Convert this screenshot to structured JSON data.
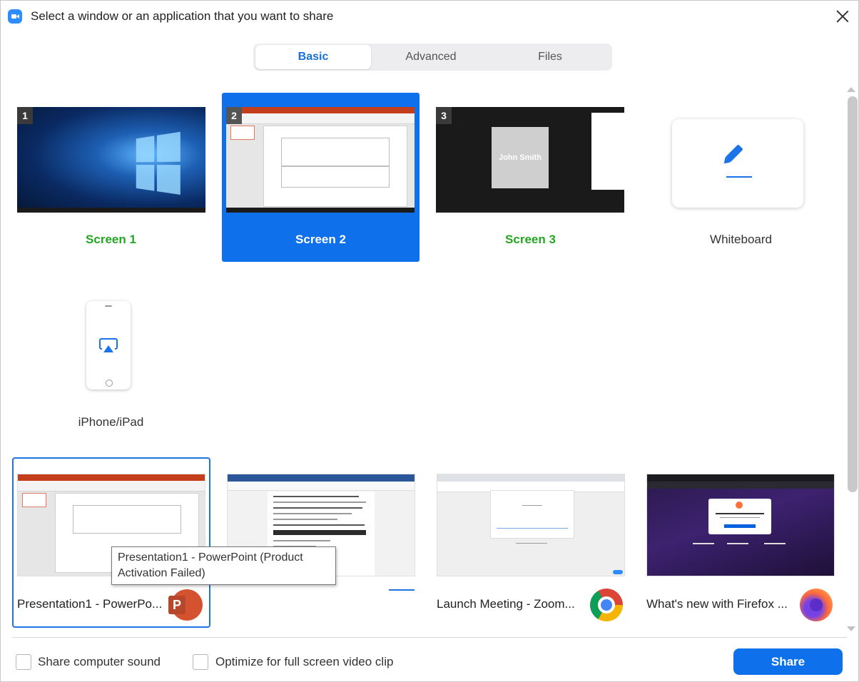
{
  "window": {
    "title": "Select a window or an application that you want to share",
    "app_icon": "zoom-camera-icon",
    "close_icon": "close-icon"
  },
  "tabs": [
    {
      "label": "Basic",
      "active": true
    },
    {
      "label": "Advanced",
      "active": false
    },
    {
      "label": "Files",
      "active": false
    }
  ],
  "screens": [
    {
      "label": "Screen 1",
      "badge": "1",
      "selected": false
    },
    {
      "label": "Screen 2",
      "badge": "2",
      "selected": true
    },
    {
      "label": "Screen 3",
      "badge": "3",
      "selected": false,
      "participant_name": "John Smith"
    },
    {
      "label": "Whiteboard",
      "icon": "pen-icon"
    },
    {
      "label": "iPhone/iPad",
      "icon": "airplay-icon"
    }
  ],
  "apps": [
    {
      "label": "Presentation1 - PowerPo...",
      "icon": "powerpoint-icon",
      "selected": true
    },
    {
      "label": "",
      "icon": "word-icon",
      "selected": false
    },
    {
      "label": "Launch Meeting - Zoom...",
      "icon": "chrome-icon",
      "selected": false
    },
    {
      "label": "What's new with Firefox ...",
      "icon": "firefox-icon",
      "selected": false
    }
  ],
  "tooltip": {
    "text": "Presentation1 - PowerPoint (Product Activation Failed)"
  },
  "footer": {
    "share_sound_label": "Share computer sound",
    "optimize_label": "Optimize for full screen video clip",
    "share_button": "Share"
  },
  "colors": {
    "accent": "#0e71eb",
    "screen_label_green": "#22a722"
  }
}
